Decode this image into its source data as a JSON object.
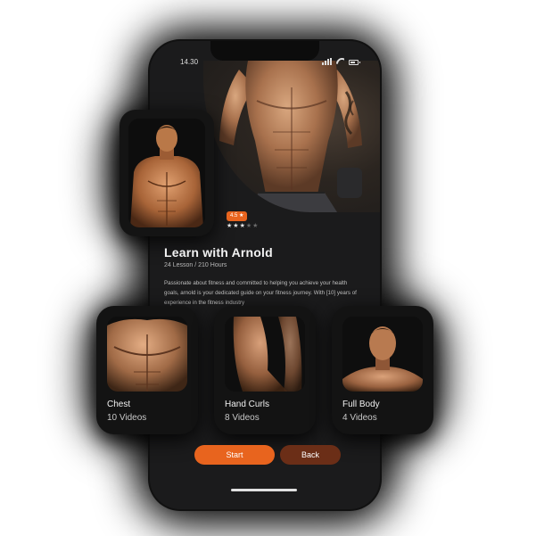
{
  "status_bar": {
    "time": "14.30"
  },
  "hero": {
    "rating": "4.5",
    "star_glyph": "★",
    "stars": [
      true,
      true,
      true,
      false,
      false
    ]
  },
  "course": {
    "title": "Learn with Arnold",
    "subtitle": "24 Lesson / 210 Hours",
    "description": "Passionate about fitness and committed to helping you achieve your health goals, arnold is your dedicated guide on your fitness journey. With [10] years of experience in the fitness industry"
  },
  "categories": [
    {
      "name": "Chest",
      "count": "10 Videos"
    },
    {
      "name": "Hand Curls",
      "count": "8 Videos"
    },
    {
      "name": "Full Body",
      "count": "4 Videos"
    }
  ],
  "actions": {
    "start_label": "Start",
    "back_label": "Back"
  },
  "colors": {
    "accent": "#e8641e",
    "accent_dark": "#6b2e17",
    "background": "#1b1b1c"
  }
}
